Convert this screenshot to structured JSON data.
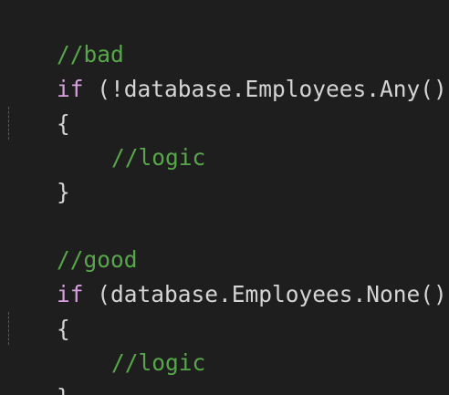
{
  "colors": {
    "background": "#1e1e1e",
    "comment": "#57a64a",
    "keyword": "#d8a0df",
    "plain": "#d4d4d4",
    "indent_guide": "#5a5a5a"
  },
  "code": {
    "block_bad": {
      "comment": "//bad",
      "keyword": "if",
      "condition": " (!database.Employees.Any())",
      "open_brace": "{",
      "body_comment": "//logic",
      "close_brace": "}"
    },
    "block_good": {
      "comment": "//good",
      "keyword": "if",
      "condition": " (database.Employees.None())",
      "open_brace": "{",
      "body_comment": "//logic",
      "close_brace": "}"
    }
  }
}
